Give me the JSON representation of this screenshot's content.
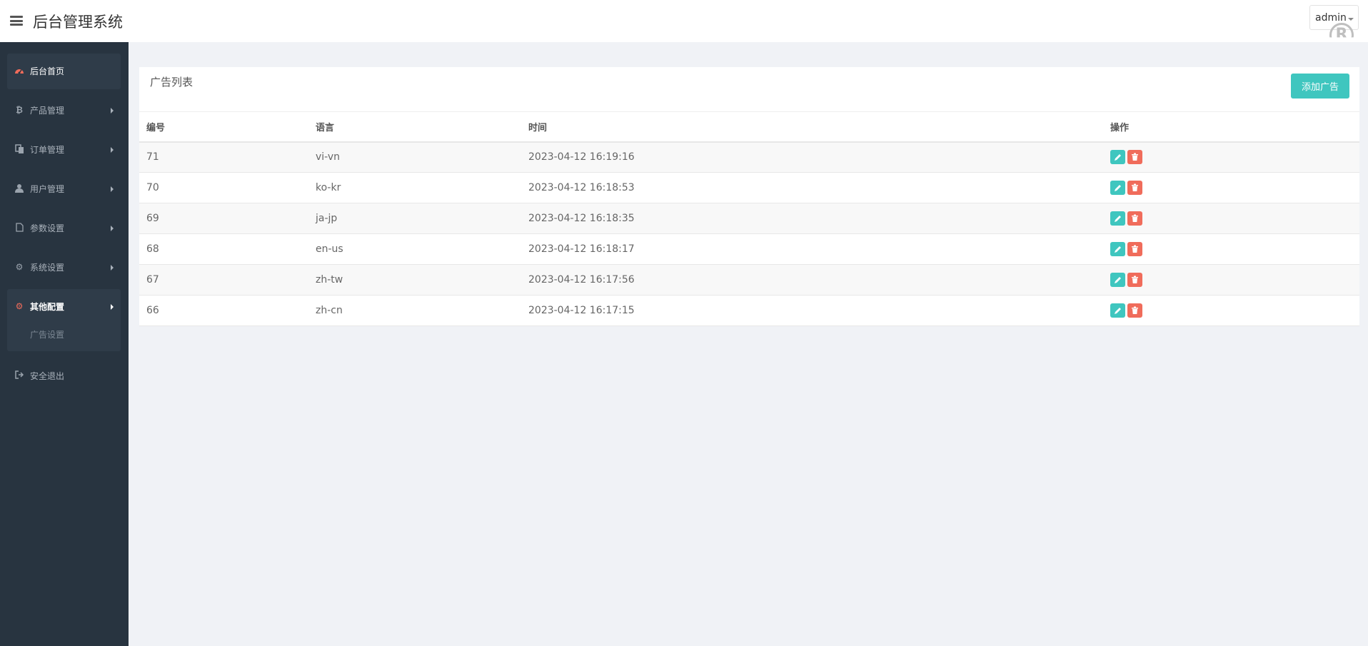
{
  "header": {
    "title": "后台管理系统",
    "user": "admin"
  },
  "sidebar": {
    "items": [
      {
        "label": "后台首页",
        "icon": "dashboard-icon"
      },
      {
        "label": "产品管理",
        "icon": "bitcoin-icon"
      },
      {
        "label": "订单管理",
        "icon": "copy-icon"
      },
      {
        "label": "用户管理",
        "icon": "user-icon"
      },
      {
        "label": "参数设置",
        "icon": "file-icon"
      },
      {
        "label": "系统设置",
        "icon": "gears-icon"
      },
      {
        "label": "其他配置",
        "icon": "cog-icon"
      },
      {
        "label": "安全退出",
        "icon": "sign-out-icon"
      }
    ],
    "sub_item": "广告设置"
  },
  "panel": {
    "title": "广告列表",
    "add_button": "添加广告",
    "columns": [
      "编号",
      "语言",
      "时间",
      "操作"
    ],
    "rows": [
      {
        "id": "71",
        "lang": "vi-vn",
        "time": "2023-04-12 16:19:16"
      },
      {
        "id": "70",
        "lang": "ko-kr",
        "time": "2023-04-12 16:18:53"
      },
      {
        "id": "69",
        "lang": "ja-jp",
        "time": "2023-04-12 16:18:35"
      },
      {
        "id": "68",
        "lang": "en-us",
        "time": "2023-04-12 16:18:17"
      },
      {
        "id": "67",
        "lang": "zh-tw",
        "time": "2023-04-12 16:17:56"
      },
      {
        "id": "66",
        "lang": "zh-cn",
        "time": "2023-04-12 16:17:15"
      }
    ]
  },
  "colors": {
    "accent": "#3fc6bf",
    "danger": "#f06c5b",
    "sidebar": "#283440"
  }
}
